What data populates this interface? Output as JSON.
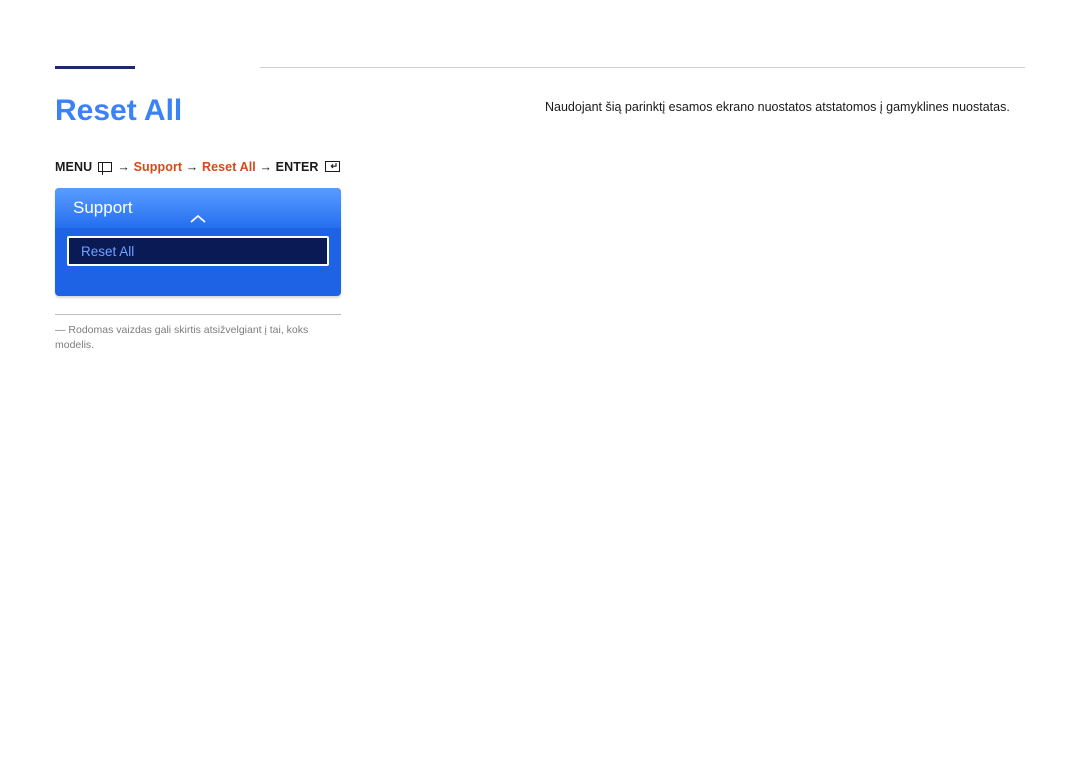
{
  "title": "Reset All",
  "nav": {
    "menu_label": "MENU",
    "arrow": "→",
    "support": "Support",
    "reset_all": "Reset All",
    "enter_label": "ENTER"
  },
  "panel": {
    "header": "Support",
    "item_reset_all": "Reset All"
  },
  "footnote": "Rodomas vaizdas gali skirtis atsižvelgiant į tai, koks modelis.",
  "description": "Naudojant šią parinktį esamos ekrano nuostatos atstatomos į gamyklines nuostatas."
}
